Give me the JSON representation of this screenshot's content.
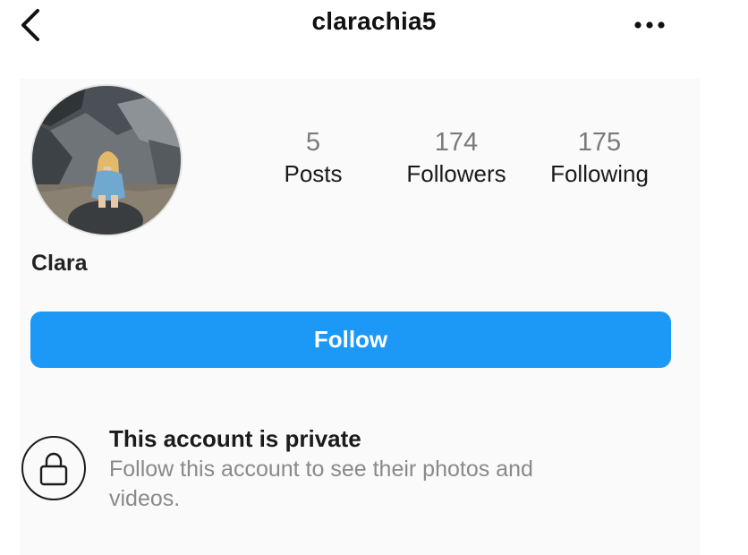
{
  "header": {
    "username": "clarachia5",
    "back_icon": "chevron-left-icon",
    "more_icon": "ellipsis-horizontal-icon"
  },
  "profile": {
    "display_name": "Clara",
    "avatar_icon": "profile-photo"
  },
  "stats": [
    {
      "count": "5",
      "label": "Posts"
    },
    {
      "count": "174",
      "label": "Followers"
    },
    {
      "count": "175",
      "label": "Following"
    }
  ],
  "actions": {
    "follow_label": "Follow",
    "follow_color": "#1c98f7"
  },
  "private_notice": {
    "icon": "lock-icon",
    "title": "This account is private",
    "description": "Follow this account to see their photos and videos."
  }
}
